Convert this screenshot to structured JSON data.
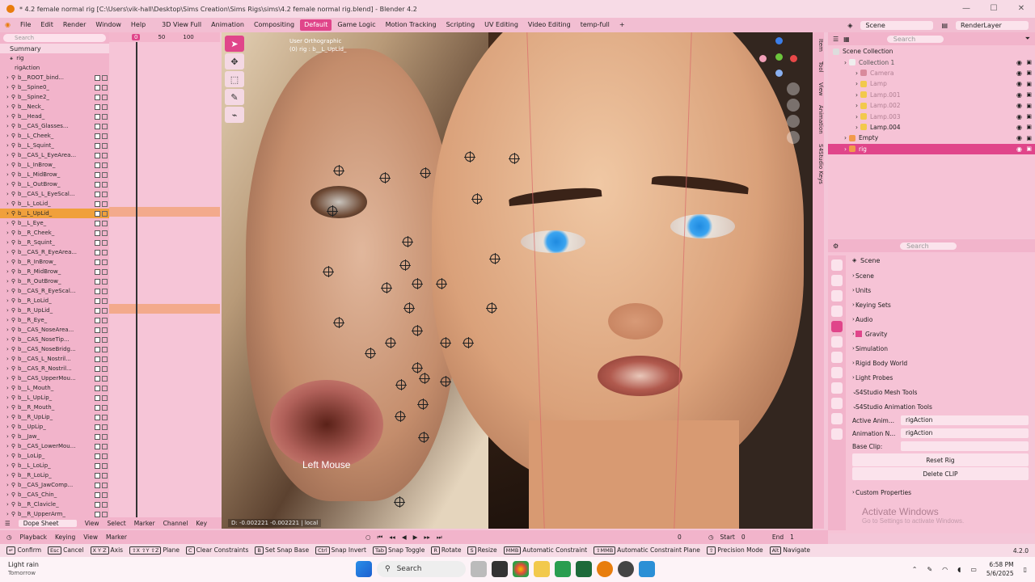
{
  "title": "* 4.2 female normal rig [C:\\Users\\vik-hall\\Desktop\\Sims Creation\\Sims Rigs\\sims\\4.2 female normal rig.blend] - Blender 4.2",
  "menu": {
    "items": [
      "File",
      "Edit",
      "Render",
      "Window",
      "Help"
    ],
    "workspaces": [
      "3D View Full",
      "Animation",
      "Compositing",
      "Default",
      "Game Logic",
      "Motion Tracking",
      "Scripting",
      "UV Editing",
      "Video Editing",
      "temp-full"
    ],
    "active_workspace": "Default",
    "add_tab": "+",
    "scene_label": "Scene",
    "renderlayer": "RenderLayer"
  },
  "window_controls": [
    "—",
    "☐",
    "✕"
  ],
  "dopesheet": {
    "search_placeholder": "Search",
    "summary": "Summary",
    "rig": "rig",
    "action": "rigAction",
    "ruler": [
      "0",
      "50",
      "100"
    ],
    "channels": [
      "b__ROOT_bind...",
      "b__Spine0_",
      "b__Spine2_",
      "b__Neck_",
      "b__Head_",
      "b__CAS_Glasses...",
      "b__L_Cheek_",
      "b__L_Squint_",
      "b__CAS_L_EyeArea...",
      "b__L_InBrow_",
      "b__L_MidBrow_",
      "b__L_OutBrow_",
      "b__CAS_L_EyeScal...",
      "b__L_LoLid_",
      "b__L_UpLid_",
      "b__L_Eye_",
      "b__R_Cheek_",
      "b__R_Squint_",
      "b__CAS_R_EyeArea...",
      "b__R_InBrow_",
      "b__R_MidBrow_",
      "b__R_OutBrow_",
      "b__CAS_R_EyeScal...",
      "b__R_LoLid_",
      "b__R_UpLid_",
      "b__R_Eye_",
      "b__CAS_NoseArea...",
      "b__CAS_NoseTip...",
      "b__CAS_NoseBridg...",
      "b__CAS_L_Nostril...",
      "b__CAS_R_Nostril...",
      "b__CAS_UpperMou...",
      "b__L_Mouth_",
      "b__L_UpLip_",
      "b__R_Mouth_",
      "b__R_UpLip_",
      "b__UpLip_",
      "b__Jaw_",
      "b__CAS_LowerMou...",
      "b__LoLip_",
      "b__L_LoLip_",
      "b__R_LoLip_",
      "b__CAS_JawComp...",
      "b__CAS_Chin_",
      "b__R_Clavicle_",
      "b__R_UpperArm_"
    ],
    "highlighted": [
      14,
      24
    ],
    "mode": "Dope Sheet",
    "menus": [
      "View",
      "Select",
      "Marker",
      "Channel",
      "Key"
    ]
  },
  "viewport": {
    "view_name": "User Orthographic",
    "view_sub": "(0) rig : b__L_UpLid_",
    "overlay_text": "Left Mouse",
    "status": "D: -0.002221  -0.002221 | local",
    "tabs": [
      "Item",
      "Tool",
      "View",
      "Animation",
      "S4Studio Keys"
    ]
  },
  "outliner": {
    "search_placeholder": "Search",
    "scene_collection": "Scene Collection",
    "items": [
      {
        "name": "Collection 1",
        "indent": 1,
        "color": "#555"
      },
      {
        "name": "Camera",
        "indent": 2,
        "color": "#b07f92"
      },
      {
        "name": "Lamp",
        "indent": 2,
        "color": "#b07f92"
      },
      {
        "name": "Lamp.001",
        "indent": 2,
        "color": "#b07f92"
      },
      {
        "name": "Lamp.002",
        "indent": 2,
        "color": "#b07f92"
      },
      {
        "name": "Lamp.003",
        "indent": 2,
        "color": "#b07f92"
      },
      {
        "name": "Lamp.004",
        "indent": 2,
        "color": "#222"
      },
      {
        "name": "Empty",
        "indent": 1,
        "color": "#222"
      },
      {
        "name": "rig",
        "indent": 1,
        "color": "#fff",
        "selected": true
      }
    ]
  },
  "properties": {
    "search_placeholder": "Search",
    "title": "Scene",
    "sections": [
      "Scene",
      "Units",
      "Keying Sets",
      "Audio",
      "Gravity",
      "Simulation",
      "Rigid Body World",
      "Light Probes",
      "S4Studio Mesh Tools",
      "S4Studio Animation Tools"
    ],
    "active_anim_label": "Active Anim...",
    "active_anim_value": "rigAction",
    "anim_name_label": "Animation N...",
    "anim_name_value": "rigAction",
    "base_clip_label": "Base Clip:",
    "base_clip_value": "",
    "reset_rig": "Reset Rig",
    "delete_clip": "Delete CLIP",
    "custom_props": "Custom Properties"
  },
  "activate": {
    "line1": "Activate Windows",
    "line2": "Go to Settings to activate Windows."
  },
  "playback": {
    "items": [
      "Playback",
      "Keying",
      "View",
      "Marker"
    ],
    "current": "0",
    "start_label": "Start",
    "start": "0",
    "end_label": "End",
    "end": "1"
  },
  "statusbar": {
    "items": [
      {
        "key": "↵",
        "label": "Confirm"
      },
      {
        "key": "Esc",
        "label": "Cancel"
      },
      {
        "key": "X Y Z",
        "label": "Axis"
      },
      {
        "key": "⇧X ⇧Y ⇧Z",
        "label": "Plane"
      },
      {
        "key": "C",
        "label": "Clear Constraints"
      },
      {
        "key": "B",
        "label": "Set Snap Base"
      },
      {
        "key": "Ctrl",
        "label": "Snap Invert"
      },
      {
        "key": "Tab",
        "label": "Snap Toggle"
      },
      {
        "key": "R",
        "label": "Rotate"
      },
      {
        "key": "S",
        "label": "Resize"
      },
      {
        "key": "MMB",
        "label": "Automatic Constraint"
      },
      {
        "key": "⇧MMB",
        "label": "Automatic Constraint Plane"
      },
      {
        "key": "⇧",
        "label": "Precision Mode"
      },
      {
        "key": "Alt",
        "label": "Navigate"
      }
    ],
    "version": "4.2.0"
  },
  "taskbar": {
    "weather_line1": "Light rain",
    "weather_line2": "Tomorrow",
    "search": "Search",
    "time": "6:58 PM",
    "date": "5/6/2025"
  },
  "colors": {
    "accent": "#e0458a",
    "panel": "#f2b4cb",
    "highlight": "#f0a03c"
  }
}
